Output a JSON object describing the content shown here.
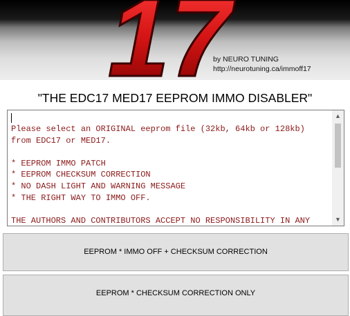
{
  "banner": {
    "logo_text": "17",
    "credit_line1": "by NEURO TUNING",
    "credit_line2": "http://neurotuning.ca/immoff17"
  },
  "headline": "\"THE EDC17 MED17 EEPROM IMMO DISABLER\"",
  "textbox": {
    "lines": [
      "Please select an ORIGINAL eeprom file (32kb, 64kb or 128kb)",
      "from EDC17 or MED17.",
      "",
      "* EEPROM IMMO PATCH",
      "* EEPROM CHECKSUM CORRECTION",
      "* NO DASH LIGHT AND WARNING MESSAGE",
      "* THE RIGHT WAY TO IMMO OFF.",
      "",
      "THE AUTHORS AND CONTRIBUTORS ACCEPT NO RESPONSIBILITY IN ANY"
    ],
    "text_color": "#8b1a1a"
  },
  "buttons": {
    "immo_off": "EEPROM *  IMMO OFF + CHECKSUM CORRECTION",
    "checksum_only": "EEPROM * CHECKSUM CORRECTION ONLY"
  },
  "icons": {
    "scroll_up": "scroll-up-arrow-icon",
    "scroll_down": "scroll-down-arrow-icon"
  },
  "colors": {
    "logo_red": "#d41414",
    "button_bg": "#e1e1e1"
  }
}
